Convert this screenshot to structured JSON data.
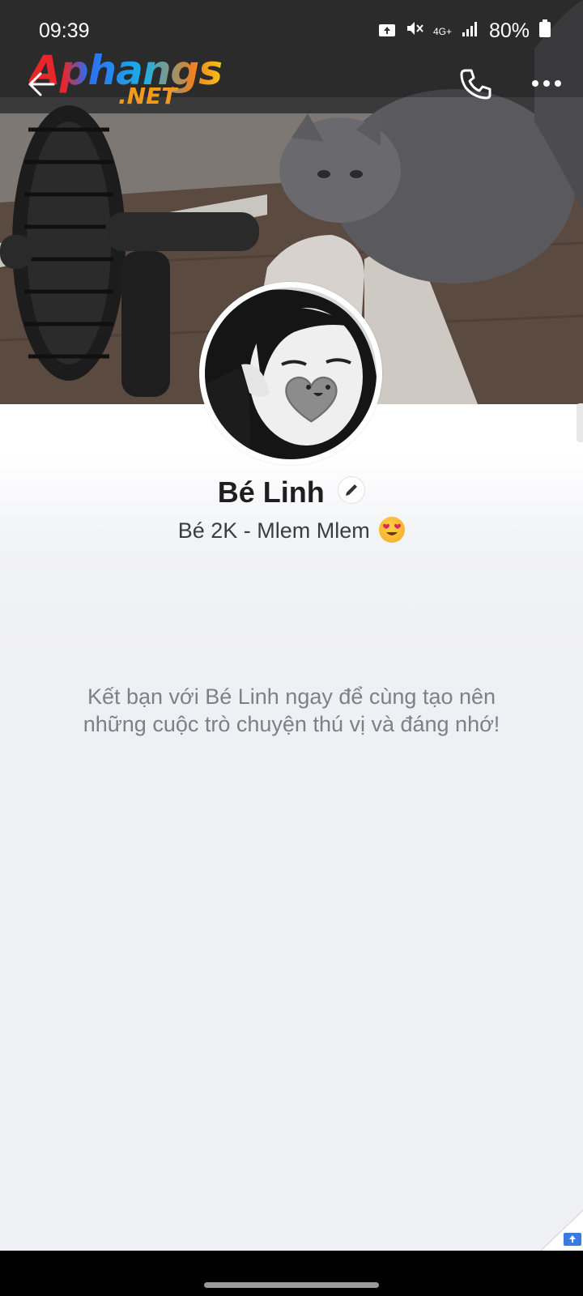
{
  "status_bar": {
    "time": "09:39",
    "network": "4G+",
    "battery": "80%"
  },
  "watermark": {
    "line1": "Aphangs",
    "line2": ".NET"
  },
  "profile": {
    "name": "Bé Linh",
    "status": "Bé 2K - Mlem Mlem"
  },
  "empty_state": {
    "line1": "Kết bạn với Bé Linh ngay để cùng tạo nên",
    "line2": "những cuộc trò chuyện thú vị và đáng nhớ!"
  },
  "icons": {
    "back": "arrow-left-icon",
    "call": "phone-icon",
    "more": "more-dots-icon",
    "edit": "pencil-icon",
    "emoji": "heart-eyes-emoji"
  },
  "colors": {
    "background": "#eff0f4",
    "name": "#1f1f1f",
    "muted_text": "#7c8189"
  }
}
